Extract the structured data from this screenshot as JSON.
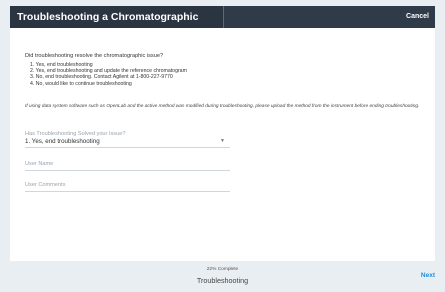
{
  "header": {
    "title": "Troubleshooting a Chromatographic Issue",
    "cancel_label": "Cancel"
  },
  "main": {
    "question": "Did troubleshooting resolve the chromatographic issue?",
    "options": [
      "1. Yes, end troubleshooting",
      "2. Yes, end troubleshooting and update the reference chromatogram",
      "3. No, end troubleshooting. Contact Agilent at 1-800-227-9770",
      "4. No, would like to continue troubleshooting"
    ],
    "note": "If using data system software such as OpenLab and the active method was modified during troubleshooting, please upload the method from the instrument before ending troubleshooting.",
    "solved_field": {
      "label": "Has Troubleshooting Solved your Issue?",
      "value": "1. Yes, end troubleshooting"
    },
    "user_name_placeholder": "User Name",
    "user_comments_placeholder": "User Comments"
  },
  "footer": {
    "progress_text": "22% Complete",
    "step_name": "Troubleshooting",
    "next_label": "Next"
  }
}
